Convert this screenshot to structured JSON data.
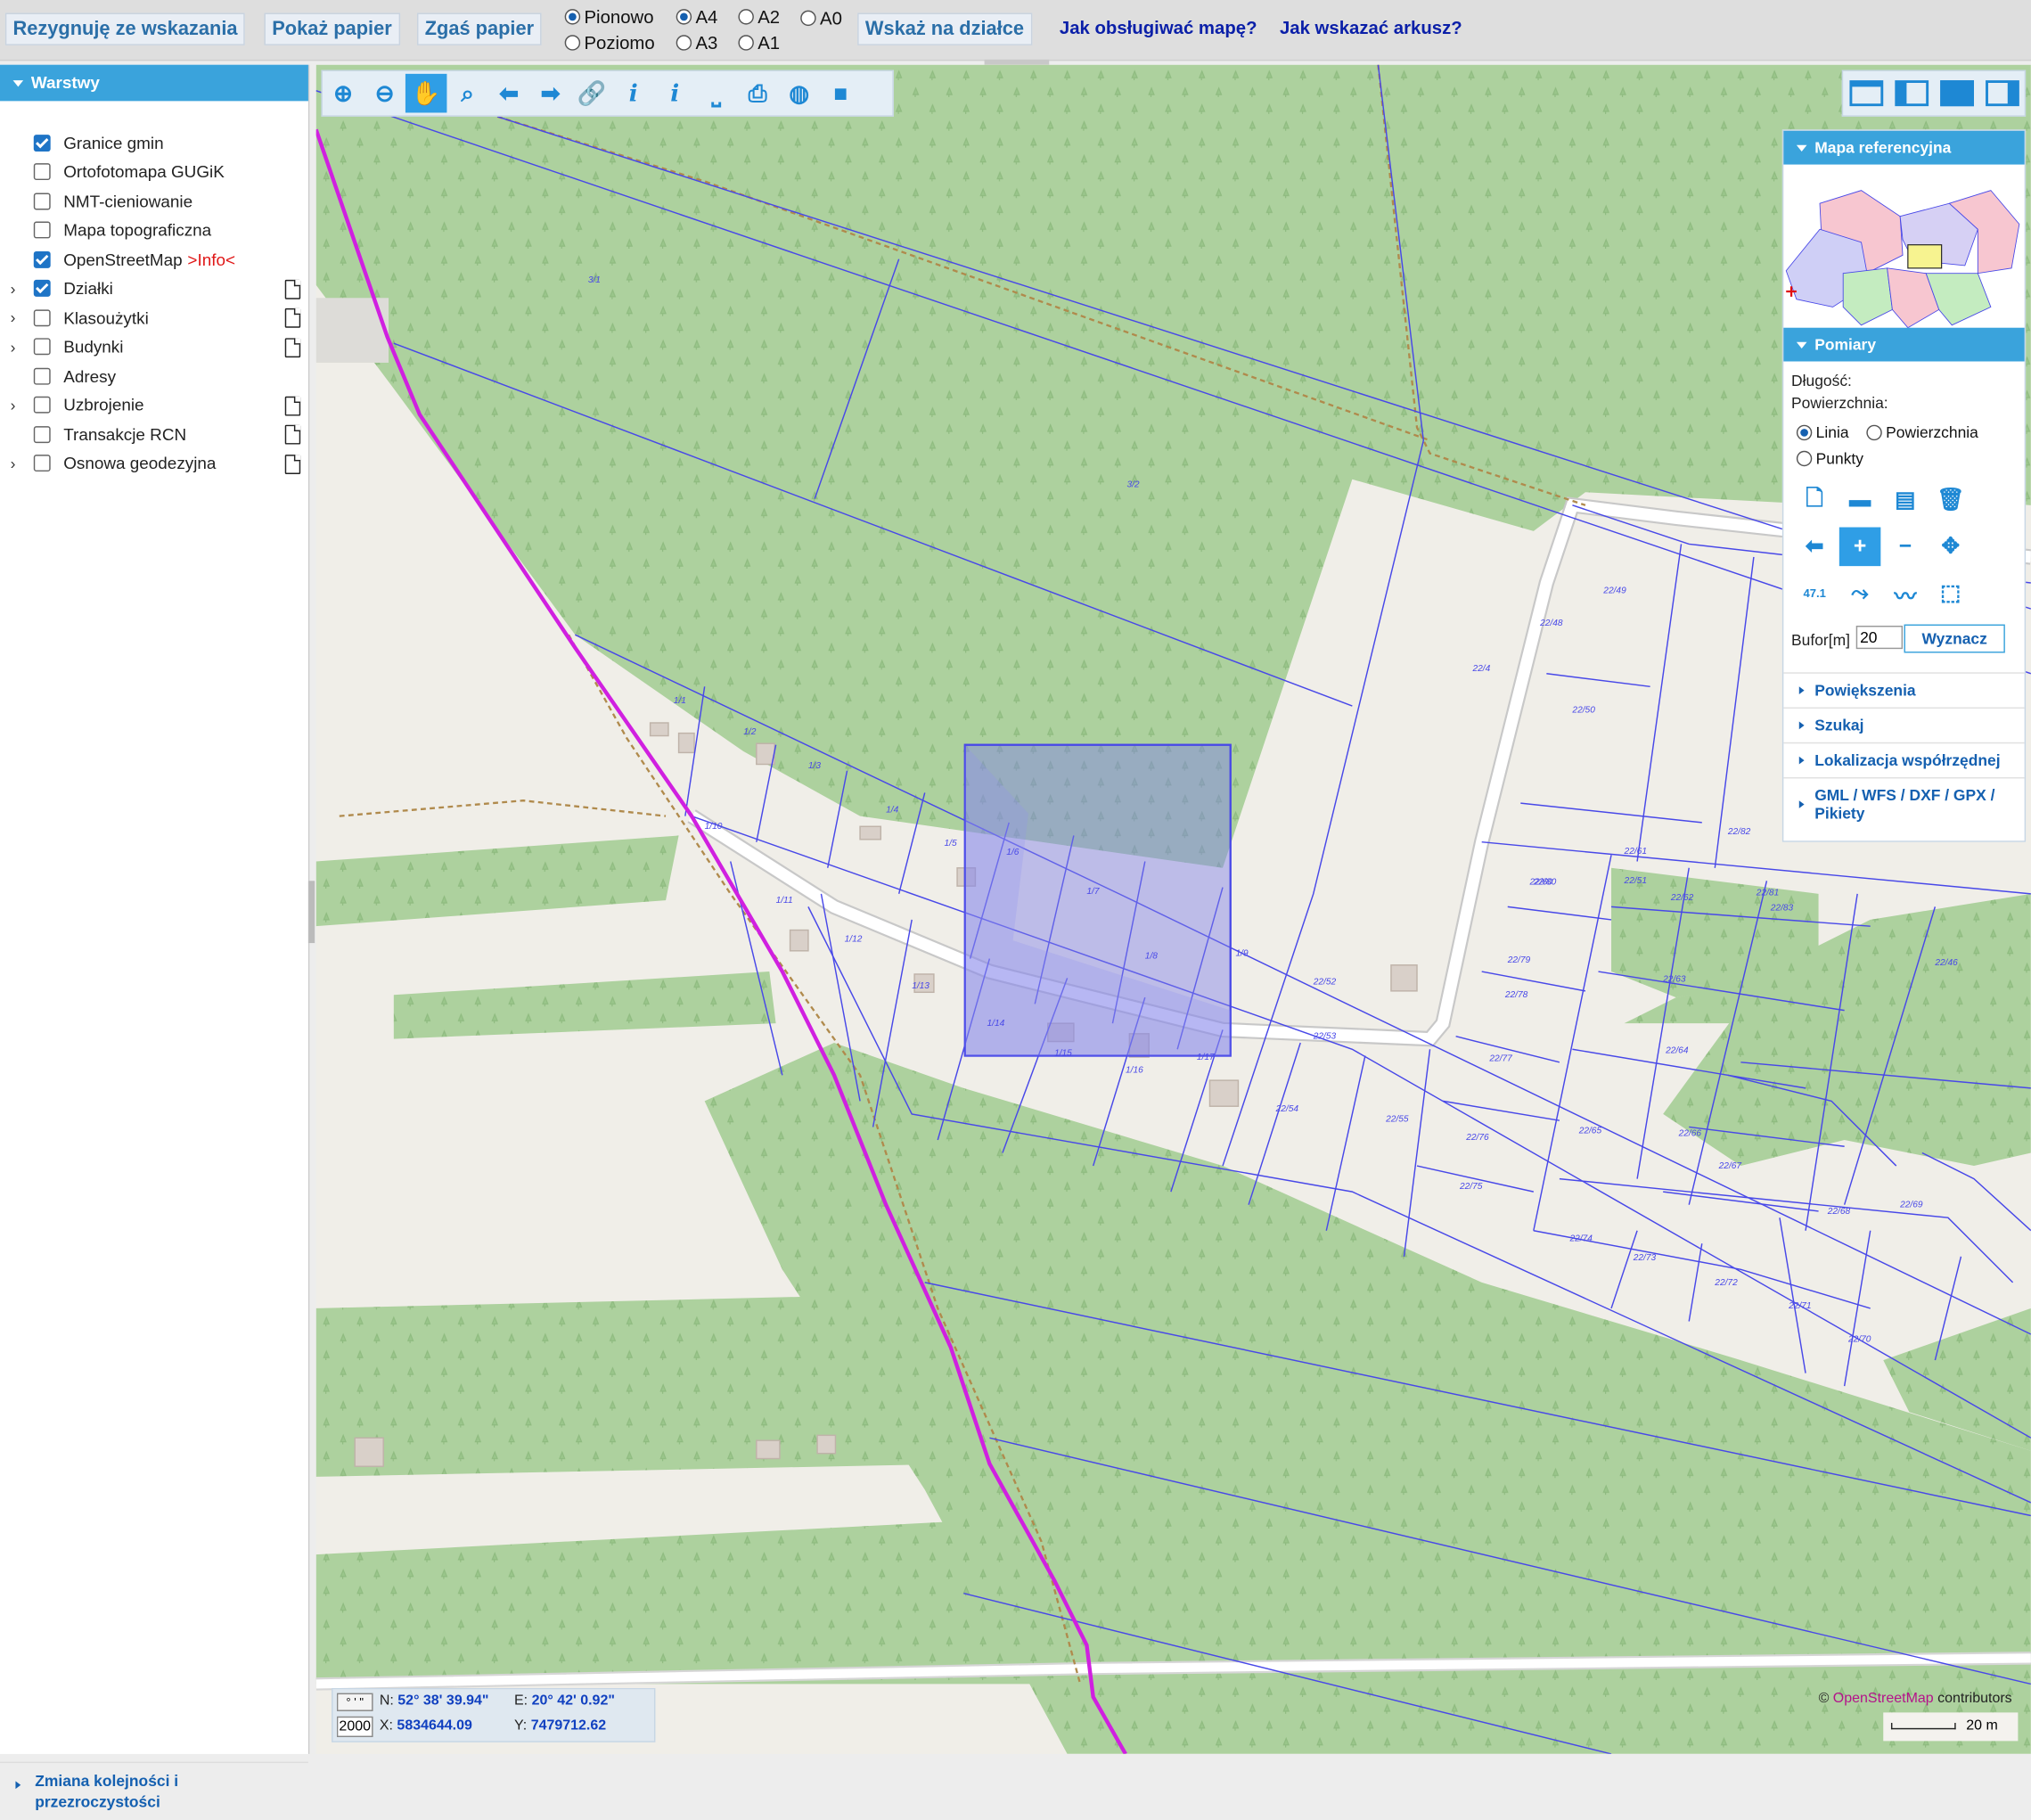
{
  "topbar": {
    "btn_resign": "Rezygnuję ze wskazania",
    "btn_show_paper": "Pokaż papier",
    "btn_hide_paper": "Zgaś papier",
    "orientation": {
      "portrait": "Pionowo",
      "landscape": "Poziomo",
      "selected": "Pionowo"
    },
    "formats": {
      "a4": "A4",
      "a3": "A3",
      "a2": "A2",
      "a1": "A1",
      "a0": "A0",
      "selected": "A4"
    },
    "btn_point_on_parcel": "Wskaż na działce",
    "link_help_map": "Jak obsługiwać mapę?",
    "link_help_sheet": "Jak wskazać arkusz?"
  },
  "layers_panel": {
    "title": "Warstwy",
    "items": [
      {
        "label": "Granice gmin",
        "checked": true,
        "expandable": false,
        "doc": false
      },
      {
        "label": "Ortofotomapa GUGiK",
        "checked": false,
        "expandable": false,
        "doc": false
      },
      {
        "label": "NMT-cieniowanie",
        "checked": false,
        "expandable": false,
        "doc": false
      },
      {
        "label": "Mapa topograficzna",
        "checked": false,
        "expandable": false,
        "doc": false
      },
      {
        "label": "OpenStreetMap",
        "checked": true,
        "expandable": false,
        "doc": false,
        "extra": ">Info<"
      },
      {
        "label": "Działki",
        "checked": true,
        "expandable": true,
        "doc": true
      },
      {
        "label": "Klasoużytki",
        "checked": false,
        "expandable": true,
        "doc": true
      },
      {
        "label": "Budynki",
        "checked": false,
        "expandable": true,
        "doc": true
      },
      {
        "label": "Adresy",
        "checked": false,
        "expandable": false,
        "doc": false
      },
      {
        "label": "Uzbrojenie",
        "checked": false,
        "expandable": true,
        "doc": true
      },
      {
        "label": "Transakcje RCN",
        "checked": false,
        "expandable": false,
        "doc": true
      },
      {
        "label": "Osnowa geodezyjna",
        "checked": false,
        "expandable": true,
        "doc": true
      }
    ],
    "footer": "Zmiana kolejności i przezroczystości"
  },
  "map_toolbar": [
    "zoom-in-icon",
    "zoom-out-icon",
    "pan-hand-icon",
    "zoom-box-icon",
    "back-arrow-icon",
    "forward-arrow-icon",
    "link-icon",
    "info-icon",
    "info-plus-icon",
    "measure-icon",
    "print-icon",
    "globe-icon",
    "camera-icon"
  ],
  "right_panel": {
    "reference_map_title": "Mapa referencyjna",
    "measurements_title": "Pomiary",
    "length_label": "Długość:",
    "area_label": "Powierzchnia:",
    "mode_options": [
      "Linia",
      "Powierzchnia",
      "Punkty"
    ],
    "mode_selected": "Linia",
    "buffer_label": "Bufor[m]",
    "buffer_value": "20",
    "compute_button": "Wyznacz",
    "accordions": [
      "Powiększenia",
      "Szukaj",
      "Lokalizacja współrzędnej",
      "GML / WFS / DXF / GPX / Pikiety"
    ]
  },
  "coords": {
    "format_badge": "° ' \"",
    "scale_badge": "2000",
    "n_label": "N:",
    "n_value": "52° 38' 39.94\"",
    "e_label": "E:",
    "e_value": "20° 42' 0.92\"",
    "x_label": "X:",
    "x_value": "5834644.09",
    "y_label": "Y:",
    "y_value": "7479712.62"
  },
  "attribution": {
    "prefix": "©",
    "osm": "OpenStreetMap",
    "suffix": "contributors"
  },
  "scale_bar": {
    "label": "20 m"
  },
  "parcel_labels": [
    "1/1",
    "1/2",
    "1/3",
    "1/4",
    "1/5",
    "1/6",
    "1/7",
    "1/8",
    "1/9",
    "1/10",
    "1/11",
    "1/12",
    "1/13",
    "1/14",
    "1/15",
    "1/16",
    "1/17",
    "3/1",
    "3/2",
    "22/4",
    "22/49",
    "22/48",
    "22/50",
    "22/51",
    "22/52",
    "22/53",
    "22/54",
    "22/55",
    "22/60",
    "22/61",
    "22/62",
    "22/63",
    "22/64",
    "22/65",
    "22/66",
    "22/67",
    "22/68",
    "22/69",
    "22/70",
    "22/71",
    "22/72",
    "22/73",
    "22/74",
    "22/75",
    "22/76",
    "22/77",
    "22/78",
    "22/79",
    "22/80",
    "22/81",
    "22/82",
    "22/83",
    "22/46"
  ],
  "colors": {
    "accent": "#3aa3dc",
    "forest": "#add19e",
    "parcel_line": "#4848e8",
    "boundary": "#d020e0",
    "selection_fill": "#7f7fe8"
  }
}
